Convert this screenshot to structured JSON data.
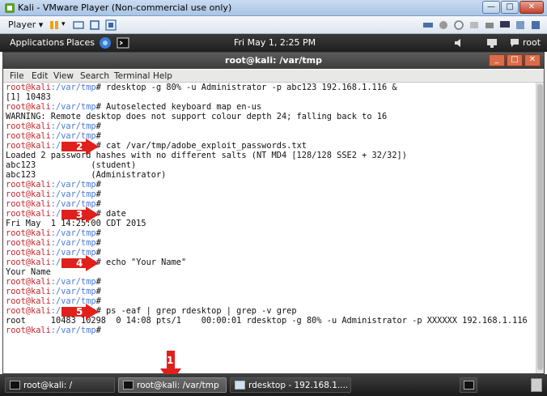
{
  "vm_window": {
    "title": "Kali - VMware Player (Non-commercial use only)",
    "player_menu_label": "Player",
    "title_icon": "vmware-icon",
    "title_icon_color": "#5aa02c"
  },
  "gnome_panel": {
    "applications_label": "Applications",
    "places_label": "Places",
    "clock": "Fri May  1,  2:25 PM",
    "user_label": "root"
  },
  "terminal": {
    "title": "root@kali: /var/tmp",
    "menu": [
      "File",
      "Edit",
      "View",
      "Search",
      "Terminal",
      "Help"
    ],
    "prompt_user": "root@kali",
    "prompt_path": ":/var/tmp",
    "prompt_hash": "#",
    "lines": [
      {
        "type": "prompt",
        "cmd": " rdesktop -g 80% -u Administrator -p abc123 192.168.1.116 &"
      },
      {
        "type": "output",
        "text": "[1] 10483"
      },
      {
        "type": "prompt",
        "cmd": " Autoselected keyboard map en-us"
      },
      {
        "type": "output",
        "text": "WARNING: Remote desktop does not support colour depth 24; falling back to 16"
      },
      {
        "type": "prompt",
        "cmd": ""
      },
      {
        "type": "prompt",
        "cmd": ""
      },
      {
        "type": "prompt",
        "cmd": " cat /var/tmp/adobe_exploit_passwords.txt"
      },
      {
        "type": "output",
        "text": "Loaded 2 password hashes with no different salts (NT MD4 [128/128 SSE2 + 32/32])"
      },
      {
        "type": "output",
        "text": "abc123           (student)"
      },
      {
        "type": "output",
        "text": "abc123           (Administrator)"
      },
      {
        "type": "prompt",
        "cmd": ""
      },
      {
        "type": "prompt",
        "cmd": ""
      },
      {
        "type": "prompt",
        "cmd": ""
      },
      {
        "type": "prompt",
        "cmd": " date"
      },
      {
        "type": "output",
        "text": "Fri May  1 14:25:00 CDT 2015"
      },
      {
        "type": "prompt",
        "cmd": ""
      },
      {
        "type": "prompt",
        "cmd": ""
      },
      {
        "type": "prompt",
        "cmd": ""
      },
      {
        "type": "prompt",
        "cmd": " echo \"Your Name\""
      },
      {
        "type": "output",
        "text": "Your Name"
      },
      {
        "type": "prompt",
        "cmd": ""
      },
      {
        "type": "prompt",
        "cmd": ""
      },
      {
        "type": "prompt",
        "cmd": ""
      },
      {
        "type": "prompt",
        "cmd": " ps -eaf | grep rdesktop | grep -v grep"
      },
      {
        "type": "output",
        "text": "root     10483 10298  0 14:08 pts/1    00:00:01 rdesktop -g 80% -u Administrator -p XXXXXX 192.168.1.116"
      },
      {
        "type": "prompt",
        "cmd": ""
      }
    ]
  },
  "annotations": [
    {
      "label": "1",
      "color": "#e0201c"
    },
    {
      "label": "2",
      "color": "#e0201c"
    },
    {
      "label": "3",
      "color": "#e0201c"
    },
    {
      "label": "4",
      "color": "#e0201c"
    },
    {
      "label": "5",
      "color": "#e0201c"
    }
  ],
  "taskbar": {
    "items": [
      {
        "label": "root@kali: /",
        "icon": "terminal-icon"
      },
      {
        "label": "root@kali: /var/tmp",
        "icon": "terminal-icon",
        "active": true
      },
      {
        "label": "rdesktop - 192.168.1....",
        "icon": "rdesktop-icon"
      }
    ]
  }
}
